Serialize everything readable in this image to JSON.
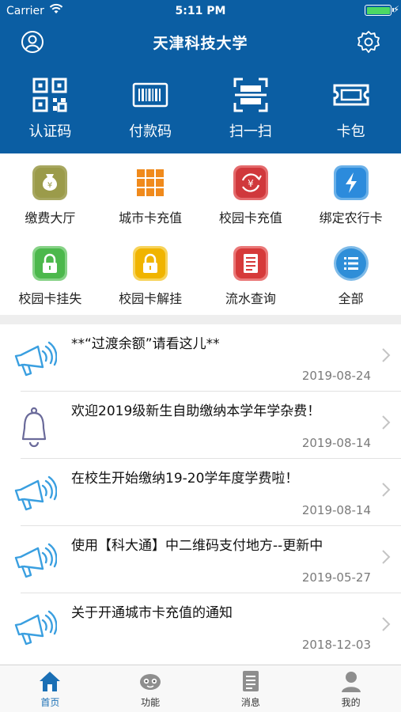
{
  "status_bar": {
    "carrier": "Carrier",
    "time": "5:11 PM"
  },
  "header": {
    "title": "天津科技大学"
  },
  "quick_actions": [
    {
      "label": "认证码",
      "icon": "qr-code-icon"
    },
    {
      "label": "付款码",
      "icon": "barcode-icon"
    },
    {
      "label": "扫一扫",
      "icon": "scan-icon"
    },
    {
      "label": "卡包",
      "icon": "ticket-icon"
    }
  ],
  "functions": [
    {
      "label": "缴费大厅",
      "icon": "money-bag-icon",
      "color": "#9b9b4a"
    },
    {
      "label": "城市卡充值",
      "icon": "grid-card-icon",
      "color": "#f08a1c"
    },
    {
      "label": "校园卡充值",
      "icon": "yen-recharge-icon",
      "color": "#d0383c"
    },
    {
      "label": "绑定农行卡",
      "icon": "lightning-icon",
      "color": "#2c8bdc"
    },
    {
      "label": "校园卡挂失",
      "icon": "lock-icon",
      "color": "#4cb84c"
    },
    {
      "label": "校园卡解挂",
      "icon": "unlock-icon",
      "color": "#f0b400"
    },
    {
      "label": "流水查询",
      "icon": "document-icon",
      "color": "#d63a3a"
    },
    {
      "label": "全部",
      "icon": "list-icon",
      "color": "#2e8ed8"
    }
  ],
  "news": [
    {
      "title": "**“过渡余额”请看这儿**",
      "date": "2019-08-24",
      "icon": "megaphone-icon"
    },
    {
      "title": "欢迎2019级新生自助缴纳本学年学杂费！",
      "date": "2019-08-14",
      "icon": "bell-icon"
    },
    {
      "title": "在校生开始缴纳19-20学年度学费啦！",
      "date": "2019-08-14",
      "icon": "megaphone-icon"
    },
    {
      "title": "使用【科大通】中二维码支付地方--更新中",
      "date": "2019-05-27",
      "icon": "megaphone-icon"
    },
    {
      "title": "关于开通城市卡充值的通知",
      "date": "2018-12-03",
      "icon": "megaphone-icon"
    }
  ],
  "tabs": [
    {
      "label": "首页",
      "icon": "home-icon",
      "active": true
    },
    {
      "label": "功能",
      "icon": "robot-icon",
      "active": false
    },
    {
      "label": "消息",
      "icon": "message-icon",
      "active": false
    },
    {
      "label": "我的",
      "icon": "profile-icon",
      "active": false
    }
  ],
  "colors": {
    "brand": "#0b5ea3",
    "tab_active": "#1a6fb5"
  }
}
